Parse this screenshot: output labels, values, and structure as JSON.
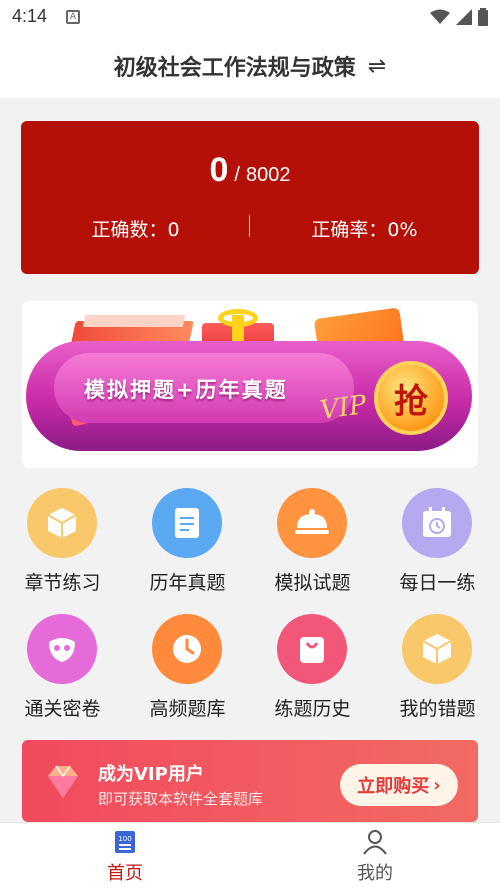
{
  "status": {
    "time": "4:14",
    "notif_icon": "a-notification-icon"
  },
  "header": {
    "title": "初级社会工作法规与政策",
    "switch_icon": "swap-arrows-icon"
  },
  "score": {
    "current": "0",
    "separator": "/",
    "total": "8002",
    "correct_count_label": "正确数：0",
    "correct_rate_label": "正确率：0%",
    "card_color": "#b51008"
  },
  "banner": {
    "text": "模拟押题+历年真题",
    "vip": "VIP",
    "grab": "抢"
  },
  "grid": {
    "items": [
      {
        "label": "章节练习",
        "icon": "cube-icon",
        "color": "#f9c86a"
      },
      {
        "label": "历年真题",
        "icon": "document-icon",
        "color": "#5ba9f2"
      },
      {
        "label": "模拟试题",
        "icon": "cloche-icon",
        "color": "#ff9340"
      },
      {
        "label": "每日一练",
        "icon": "calendar-history-icon",
        "color": "#b7a9f0"
      },
      {
        "label": "通关密卷",
        "icon": "mask-icon",
        "color": "#e46bd8"
      },
      {
        "label": "高频题库",
        "icon": "clock-icon",
        "color": "#ff8a3c"
      },
      {
        "label": "练题历史",
        "icon": "bag-icon",
        "color": "#f2577a"
      },
      {
        "label": "我的错题",
        "icon": "cube-icon",
        "color": "#f9c86a"
      }
    ]
  },
  "vip": {
    "title": "成为VIP用户",
    "subtitle": "即可获取本软件全套题库",
    "button": "立即购买"
  },
  "tabbar": {
    "tabs": [
      {
        "label": "首页",
        "icon": "home-book-icon",
        "active": true
      },
      {
        "label": "我的",
        "icon": "person-icon",
        "active": false
      }
    ]
  },
  "colors": {
    "accent": "#c8150f",
    "vip_bar": "#f14a5d"
  }
}
